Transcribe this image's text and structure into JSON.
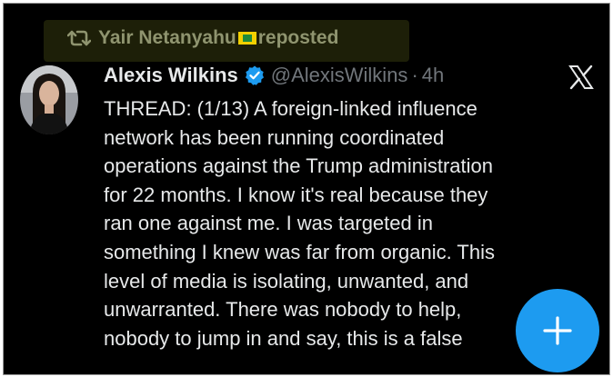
{
  "repost": {
    "user": "Yair Netanyahu",
    "label": "reposted"
  },
  "tweet": {
    "display_name": "Alexis Wilkins",
    "handle": "@AlexisWilkins",
    "separator": "·",
    "time": "4h",
    "lines": [
      "THREAD: (1/13) A foreign-linked influence",
      "network has been running coordinated",
      "operations against the Trump administration",
      "for 22 months. I know it's real because they",
      "ran one against me. I was targeted in",
      "something I knew was far from organic. This",
      "level of media is isolating, unwanted, and",
      "unwarranted. There was nobody to help,",
      "nobody to jump in and say, this is a false"
    ]
  },
  "colors": {
    "background": "#000000",
    "text": "#e7e9ea",
    "muted": "#71767b",
    "accent": "#1d9bf0",
    "repost_text": "#8f946f"
  },
  "icons": {
    "repost": "repost-icon",
    "verified": "verified-badge-icon",
    "logo": "x-logo-icon",
    "compose": "plus-icon"
  }
}
